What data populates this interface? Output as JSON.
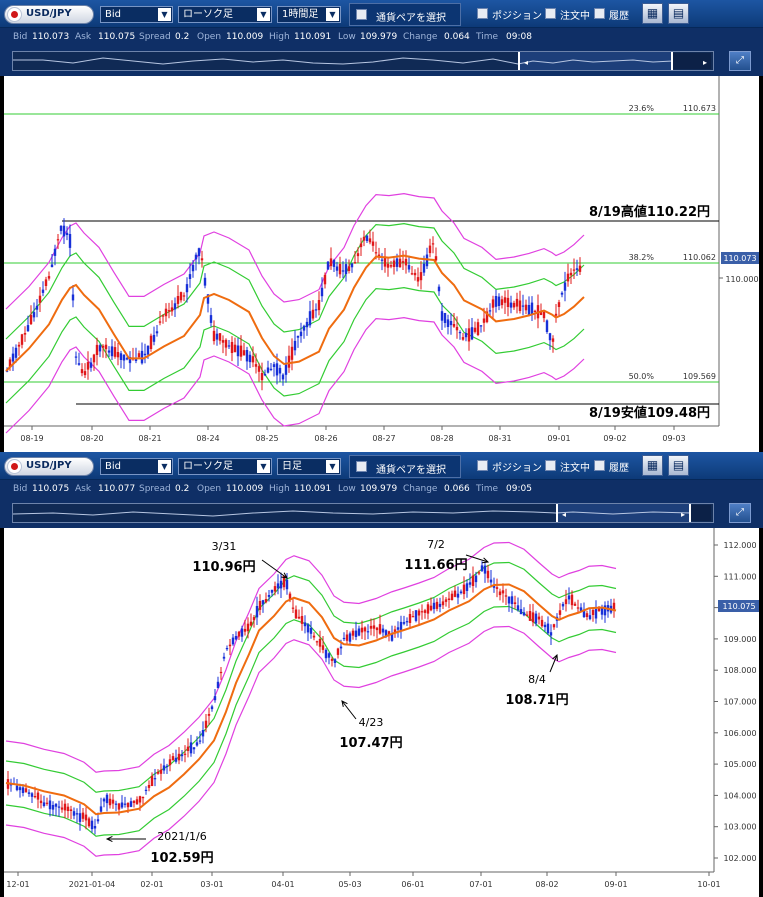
{
  "panels": [
    {
      "pair": "USD/JPY",
      "price_type": "Bid",
      "chart_type": "ローソク足",
      "timeframe": "1時間足",
      "select_pair": "通貨ペアを選択",
      "chk_position": "ポジション",
      "chk_orders": "注文中",
      "chk_history": "履歴",
      "quote": {
        "bid_label": "Bid",
        "bid": "110.073",
        "ask_label": "Ask",
        "ask": "110.075",
        "spread_label": "Spread",
        "spread": "0.2",
        "open_label": "Open",
        "open": "110.009",
        "high_label": "High",
        "high": "110.091",
        "low_label": "Low",
        "low": "109.979",
        "change_label": "Change",
        "change": "0.064",
        "time_label": "Time",
        "time": "09:08"
      },
      "x_labels": [
        "08-19",
        "08-20",
        "08-21",
        "08-24",
        "08-25",
        "08-26",
        "08-27",
        "08-28",
        "08-31",
        "09-01",
        "09-02",
        "09-03"
      ],
      "y_labels": [
        "110.000"
      ],
      "current_price": "110.073",
      "fib_labels": [
        {
          "pct": "23.6%",
          "price": "110.673"
        },
        {
          "pct": "38.2%",
          "price": "110.062"
        },
        {
          "pct": "50.0%",
          "price": "109.569"
        }
      ],
      "annotations": [
        "8/19高値110.22円",
        "8/19安値109.48円"
      ]
    },
    {
      "pair": "USD/JPY",
      "price_type": "Bid",
      "chart_type": "ローソク足",
      "timeframe": "日足",
      "select_pair": "通貨ペアを選択",
      "chk_position": "ポジション",
      "chk_orders": "注文中",
      "chk_history": "履歴",
      "quote": {
        "bid_label": "Bid",
        "bid": "110.075",
        "ask_label": "Ask",
        "ask": "110.077",
        "spread_label": "Spread",
        "spread": "0.2",
        "open_label": "Open",
        "open": "110.009",
        "high_label": "High",
        "high": "110.091",
        "low_label": "Low",
        "low": "109.979",
        "change_label": "Change",
        "change": "0.066",
        "time_label": "Time",
        "time": "09:05"
      },
      "x_labels": [
        "12-01",
        "2021-01-04",
        "02-01",
        "03-01",
        "04-01",
        "05-03",
        "06-01",
        "07-01",
        "08-02",
        "09-01",
        "10-01"
      ],
      "y_labels": [
        "112.000",
        "111.000",
        "110.000",
        "109.000",
        "108.000",
        "107.000",
        "106.000",
        "105.000",
        "104.000",
        "103.000",
        "102.000"
      ],
      "current_price": "110.075",
      "annotations": [
        {
          "date": "3/31",
          "price": "110.96円"
        },
        {
          "date": "7/2",
          "price": "111.66円"
        },
        {
          "date": "4/23",
          "price": "107.47円"
        },
        {
          "date": "8/4",
          "price": "108.71円"
        },
        {
          "date": "2021/1/6",
          "price": "102.59円"
        }
      ]
    }
  ]
}
